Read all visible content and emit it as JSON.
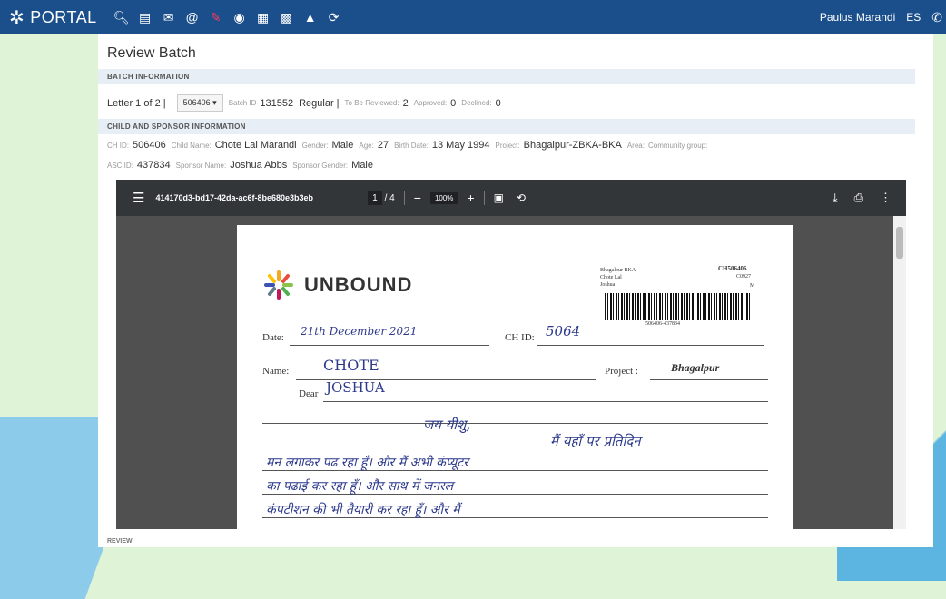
{
  "topbar": {
    "brand": "PORTAL",
    "icons": [
      "search-icon",
      "list-icon",
      "mail-icon",
      "at-icon",
      "edit-icon",
      "camera-icon",
      "barcode-icon",
      "id-card-icon",
      "graduation-icon",
      "refresh-icon"
    ],
    "user": "Paulus Marandi",
    "lang": "ES"
  },
  "page": {
    "title": "Review Batch"
  },
  "batch": {
    "section": "BATCH INFORMATION",
    "letter_text": "Letter 1 of 2 |",
    "selected_id": "506406",
    "batch_id_label": "Batch ID",
    "batch_id": "131552",
    "type": "Regular |",
    "to_be_reviewed_label": "To Be Reviewed:",
    "to_be_reviewed": "2",
    "approved_label": "Approved:",
    "approved": "0",
    "declined_label": "Declined:",
    "declined": "0"
  },
  "child": {
    "section": "CHILD AND SPONSOR INFORMATION",
    "ch_id_label": "CH ID:",
    "ch_id": "506406",
    "child_name_label": "Child Name:",
    "child_name": "Chote Lal Marandi",
    "gender_label": "Gender:",
    "gender": "Male",
    "age_label": "Age:",
    "age": "27",
    "birth_label": "Birth Date:",
    "birth": "13 May 1994",
    "project_label": "Project:",
    "project": "Bhagalpur-ZBKA-BKA",
    "area_label": "Area:",
    "community_label": "Community group:",
    "asc_label": "ASC ID:",
    "asc_id": "437834",
    "sponsor_name_label": "Sponsor Name:",
    "sponsor_name": "Joshua Abbs",
    "sponsor_gender_label": "Sponsor Gender:",
    "sponsor_gender": "Male"
  },
  "viewer": {
    "filename": "414170d3-bd17-42da-ac6f-8be680e3b3eb",
    "page_current": "1",
    "page_total": "/ 4",
    "zoom": "100%"
  },
  "letter": {
    "brand": "UNBOUND",
    "top_right_small": [
      "Bhagalpur BKA",
      "Chote Lal",
      "Joshua"
    ],
    "top_right_id": "CH506406",
    "top_right_sub": "C0927",
    "top_right_gender": "M",
    "barcode_text": "506406-437834",
    "date_label": "Date:",
    "date_value": "21th December 2021",
    "chid_label": "CH ID:",
    "chid_value": "5064",
    "name_label": "Name:",
    "name_value": "CHOTE",
    "project_label": "Project :",
    "project_value": "Bhagalpur",
    "dear_label": "Dear",
    "dear_value": "JOSHUA",
    "lines": [
      "जय यीशु,",
      "मैं यहाँ पर प्रतिदिन",
      "मन लगाकर पढ रहा हूँ। और मैं अभी कंप्यूटर",
      "का पढाई कर रहा हूँ। और साथ में जनरल",
      "कंपटीशन की भी तैयारी कर रहा हूँ। और मैं"
    ]
  },
  "review": {
    "section": "REVIEW"
  }
}
